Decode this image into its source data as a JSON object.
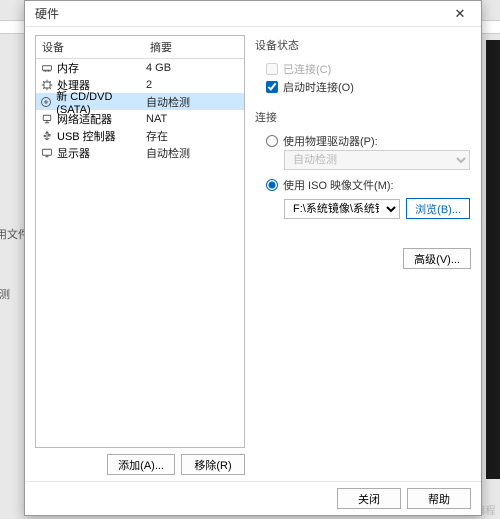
{
  "dialog": {
    "title": "硬件"
  },
  "columns": {
    "device": "设备",
    "summary": "摘要"
  },
  "devices": [
    {
      "name": "内存",
      "summary": "4 GB",
      "icon": "memory-icon"
    },
    {
      "name": "处理器",
      "summary": "2",
      "icon": "cpu-icon"
    },
    {
      "name": "新 CD/DVD (SATA)",
      "summary": "自动检测",
      "icon": "disc-icon",
      "selected": true
    },
    {
      "name": "网络适配器",
      "summary": "NAT",
      "icon": "network-icon"
    },
    {
      "name": "USB 控制器",
      "summary": "存在",
      "icon": "usb-icon"
    },
    {
      "name": "显示器",
      "summary": "自动检测",
      "icon": "display-icon"
    }
  ],
  "buttons": {
    "add": "添加(A)...",
    "remove": "移除(R)",
    "browse": "浏览(B)...",
    "advanced": "高级(V)...",
    "close": "关闭",
    "help": "帮助"
  },
  "status": {
    "title": "设备状态",
    "connected": "已连接(C)",
    "connect_on": "启动时连接(O)"
  },
  "connection": {
    "title": "连接",
    "physical": "使用物理驱动器(P):",
    "auto_detect": "自动检测",
    "iso": "使用 ISO 映像文件(M):",
    "iso_path": "F:\\系统镜像\\系统镜像iso\\ubun"
  },
  "bg": {
    "label1": "用文件",
    "label2": "测"
  },
  "watermark": "CSDN @水牛编程"
}
